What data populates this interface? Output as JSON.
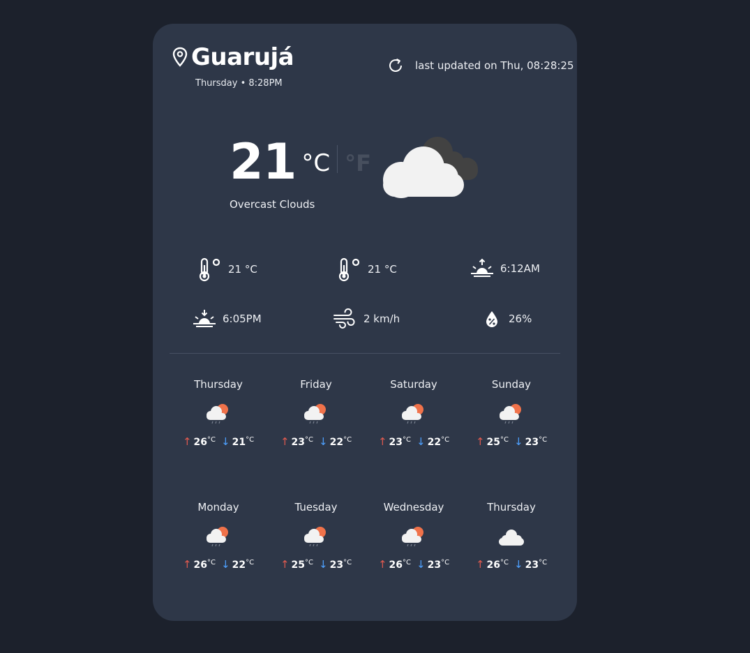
{
  "location": {
    "city": "Guarujá",
    "datetime": "Thursday • 8:28PM"
  },
  "updated": {
    "text": "last updated on Thu, 08:28:25"
  },
  "current": {
    "temperature": "21",
    "unit_c": "°C",
    "unit_f": "°F",
    "condition": "Overcast Clouds",
    "icon": "overcast-clouds-icon"
  },
  "stats": {
    "temp": "21 °C",
    "feels_like": "21 °C",
    "sunrise": "6:12AM",
    "sunset": "6:05PM",
    "wind": "2 km/h",
    "humidity": "26%"
  },
  "forecast": [
    {
      "day": "Thursday",
      "icon": "rain-sun-icon",
      "high": "26",
      "low": "21",
      "unit": "°C"
    },
    {
      "day": "Friday",
      "icon": "rain-sun-icon",
      "high": "23",
      "low": "22",
      "unit": "°C"
    },
    {
      "day": "Saturday",
      "icon": "rain-sun-icon",
      "high": "23",
      "low": "22",
      "unit": "°C"
    },
    {
      "day": "Sunday",
      "icon": "rain-sun-icon",
      "high": "25",
      "low": "23",
      "unit": "°C"
    },
    {
      "day": "Monday",
      "icon": "rain-sun-icon",
      "high": "26",
      "low": "22",
      "unit": "°C"
    },
    {
      "day": "Tuesday",
      "icon": "rain-sun-icon",
      "high": "25",
      "low": "23",
      "unit": "°C"
    },
    {
      "day": "Wednesday",
      "icon": "rain-sun-icon",
      "high": "26",
      "low": "23",
      "unit": "°C"
    },
    {
      "day": "Thursday",
      "icon": "cloud-icon",
      "high": "26",
      "low": "23",
      "unit": "°C"
    }
  ],
  "colors": {
    "background": "#1c212c",
    "card": "#2e3748",
    "high_arrow": "#e05a4f",
    "low_arrow": "#4ea1ff",
    "sun": "#f0724a"
  }
}
